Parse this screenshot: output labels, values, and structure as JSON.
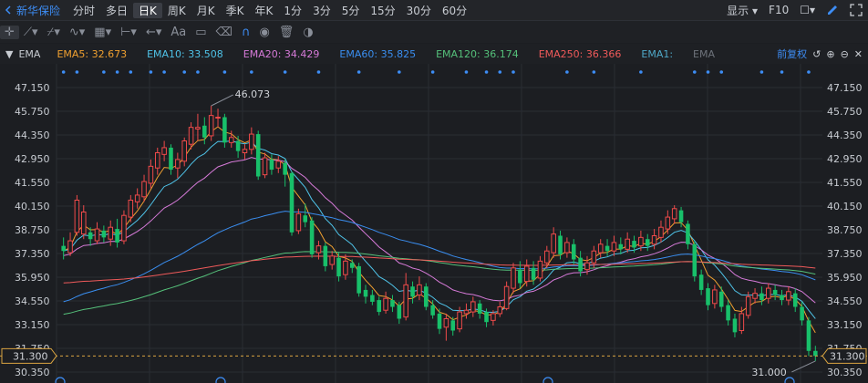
{
  "toolbar": {
    "stock_name": "新华保险",
    "periods": [
      "分时",
      "多日",
      "日K",
      "周K",
      "月K",
      "季K",
      "年K",
      "1分",
      "3分",
      "5分",
      "15分",
      "30分",
      "60分"
    ],
    "active_period": "日K",
    "display_label": "显示",
    "f10_label": "F10",
    "colors": {
      "accent": "#3d8df5"
    }
  },
  "drawing_tools": {
    "icons": [
      "crosshair-icon",
      "line-icon",
      "polyline-icon",
      "wave-icon",
      "pattern-icon",
      "measure-icon",
      "arrow-icon",
      "text-icon",
      "comment-icon",
      "eraser-icon",
      "magnet-icon",
      "eye-icon",
      "trash-icon",
      "toggle-icon"
    ],
    "text_tool_label": "Aa"
  },
  "indicator_bar": {
    "name": "EMA",
    "adjust_label": "前复权",
    "items": [
      {
        "label": "EMA5: 32.673",
        "color": "#f0a030"
      },
      {
        "label": "EMA10: 33.508",
        "color": "#4fc3e8"
      },
      {
        "label": "EMA20: 34.429",
        "color": "#d67ad8"
      },
      {
        "label": "EMA60: 35.825",
        "color": "#3a8ef0"
      },
      {
        "label": "EMA120: 36.174",
        "color": "#55c07a"
      },
      {
        "label": "EMA250: 36.366",
        "color": "#ef5a5a"
      },
      {
        "label": "EMA1:",
        "color": "#4fa8c8"
      },
      {
        "label": "EMA",
        "color": "#6e737b"
      }
    ]
  },
  "chart_data": {
    "type": "candlestick",
    "y_ticks": [
      "47.150",
      "45.750",
      "44.350",
      "42.950",
      "41.550",
      "40.150",
      "38.750",
      "37.350",
      "35.950",
      "34.550",
      "33.150",
      "31.750",
      "30.350"
    ],
    "ylim": [
      30.35,
      47.15
    ],
    "current_price_label": "31.300",
    "current_price": 31.3,
    "high_label": "46.073",
    "high_value": 46.073,
    "low_label": "31.000",
    "low_value": 31.0,
    "candles": [
      [
        37.8,
        37.5,
        38.3,
        37.0
      ],
      [
        37.4,
        38.1,
        38.6,
        37.2
      ],
      [
        38.6,
        40.5,
        40.8,
        38.4
      ],
      [
        38.5,
        39.8,
        40.2,
        38.2
      ],
      [
        38.6,
        38.2,
        38.9,
        37.8
      ],
      [
        38.1,
        38.8,
        39.2,
        37.9
      ],
      [
        38.7,
        38.3,
        39.0,
        38.0
      ],
      [
        38.2,
        38.9,
        39.3,
        37.8
      ],
      [
        38.8,
        38.0,
        39.4,
        37.7
      ],
      [
        38.1,
        39.6,
        39.9,
        37.9
      ],
      [
        39.5,
        40.5,
        40.8,
        39.2
      ],
      [
        40.4,
        40.8,
        41.2,
        40.0
      ],
      [
        40.7,
        41.6,
        42.0,
        40.4
      ],
      [
        41.5,
        42.5,
        42.9,
        41.2
      ],
      [
        42.4,
        43.3,
        43.6,
        42.0
      ],
      [
        43.2,
        43.6,
        44.0,
        42.8
      ],
      [
        43.6,
        42.3,
        43.8,
        42.0
      ],
      [
        42.4,
        42.9,
        43.3,
        41.8
      ],
      [
        42.8,
        44.0,
        44.2,
        42.5
      ],
      [
        43.8,
        44.8,
        45.1,
        43.5
      ],
      [
        44.7,
        44.8,
        45.6,
        44.0
      ],
      [
        44.9,
        44.2,
        45.4,
        43.8
      ],
      [
        44.3,
        45.5,
        46.073,
        44.0
      ],
      [
        45.4,
        45.4,
        45.9,
        44.8
      ],
      [
        45.4,
        43.9,
        45.6,
        43.6
      ],
      [
        43.9,
        44.2,
        44.6,
        43.6
      ],
      [
        44.0,
        43.4,
        44.3,
        43.0
      ],
      [
        43.3,
        43.5,
        43.8,
        42.9
      ],
      [
        43.5,
        44.4,
        44.8,
        43.2
      ],
      [
        44.4,
        41.9,
        44.6,
        41.7
      ],
      [
        42.0,
        43.0,
        43.3,
        41.8
      ],
      [
        42.9,
        42.3,
        43.2,
        42.0
      ],
      [
        42.4,
        42.8,
        43.1,
        42.1
      ],
      [
        42.7,
        42.0,
        42.9,
        41.3
      ],
      [
        42.1,
        38.6,
        42.2,
        38.4
      ],
      [
        38.7,
        39.7,
        40.0,
        38.5
      ],
      [
        39.6,
        39.2,
        40.3,
        38.9
      ],
      [
        39.3,
        37.3,
        39.5,
        37.1
      ],
      [
        37.4,
        37.8,
        38.1,
        37.0
      ],
      [
        37.8,
        36.6,
        38.0,
        36.3
      ],
      [
        36.7,
        37.2,
        37.5,
        36.4
      ],
      [
        37.1,
        36.0,
        37.4,
        35.7
      ],
      [
        36.1,
        36.9,
        37.3,
        35.8
      ],
      [
        36.8,
        36.5,
        37.0,
        36.2
      ],
      [
        36.6,
        35.0,
        36.8,
        34.8
      ],
      [
        35.2,
        34.8,
        35.5,
        34.4
      ],
      [
        34.9,
        34.5,
        35.2,
        34.3
      ],
      [
        34.6,
        33.9,
        34.8,
        33.7
      ],
      [
        34.0,
        34.7,
        35.1,
        33.8
      ],
      [
        34.6,
        34.2,
        34.9,
        33.9
      ],
      [
        34.3,
        33.5,
        34.5,
        33.2
      ],
      [
        33.6,
        35.5,
        36.2,
        33.4
      ],
      [
        35.4,
        34.8,
        35.7,
        34.4
      ],
      [
        34.9,
        35.5,
        36.0,
        34.6
      ],
      [
        35.4,
        34.2,
        35.6,
        34.0
      ],
      [
        34.3,
        33.7,
        34.6,
        33.5
      ],
      [
        33.8,
        32.9,
        34.1,
        32.6
      ],
      [
        33.0,
        33.5,
        33.8,
        32.2
      ],
      [
        33.4,
        32.8,
        33.6,
        32.5
      ],
      [
        32.9,
        33.9,
        34.2,
        32.7
      ],
      [
        33.8,
        34.0,
        34.4,
        33.5
      ],
      [
        33.9,
        34.5,
        34.8,
        33.6
      ],
      [
        34.4,
        33.8,
        34.6,
        33.5
      ],
      [
        33.9,
        33.3,
        34.1,
        33.0
      ],
      [
        33.4,
        33.8,
        34.0,
        33.1
      ],
      [
        33.8,
        34.2,
        34.5,
        33.6
      ],
      [
        34.1,
        35.4,
        35.7,
        34.0
      ],
      [
        35.3,
        36.5,
        36.8,
        35.0
      ],
      [
        36.4,
        35.6,
        36.9,
        35.3
      ],
      [
        35.7,
        36.6,
        37.0,
        35.4
      ],
      [
        36.5,
        35.8,
        36.9,
        35.5
      ],
      [
        35.9,
        36.9,
        37.2,
        35.7
      ],
      [
        36.8,
        37.5,
        37.8,
        36.5
      ],
      [
        37.4,
        38.5,
        38.9,
        37.1
      ],
      [
        38.4,
        37.3,
        38.7,
        37.0
      ],
      [
        37.4,
        38.0,
        38.3,
        37.1
      ],
      [
        37.9,
        37.0,
        38.2,
        36.7
      ],
      [
        37.1,
        36.3,
        37.5,
        36.0
      ],
      [
        36.4,
        36.8,
        37.2,
        36.1
      ],
      [
        36.8,
        37.5,
        37.8,
        36.5
      ],
      [
        37.4,
        37.9,
        38.2,
        37.1
      ],
      [
        37.8,
        37.5,
        38.2,
        37.2
      ],
      [
        37.5,
        38.0,
        38.4,
        37.2
      ],
      [
        37.9,
        37.6,
        38.3,
        37.3
      ],
      [
        37.6,
        38.2,
        38.6,
        37.4
      ],
      [
        38.1,
        37.7,
        38.4,
        37.4
      ],
      [
        37.8,
        38.3,
        38.7,
        37.5
      ],
      [
        38.2,
        37.8,
        38.5,
        37.5
      ],
      [
        37.9,
        38.4,
        38.8,
        37.6
      ],
      [
        38.3,
        38.9,
        39.3,
        38.0
      ],
      [
        38.8,
        39.5,
        39.9,
        38.5
      ],
      [
        39.4,
        40.0,
        40.2,
        39.1
      ],
      [
        39.9,
        39.2,
        40.1,
        38.9
      ],
      [
        39.1,
        37.9,
        39.3,
        37.6
      ],
      [
        37.9,
        36.0,
        38.1,
        35.7
      ],
      [
        36.1,
        35.2,
        36.4,
        34.9
      ],
      [
        35.3,
        34.3,
        35.6,
        34.0
      ],
      [
        34.4,
        35.2,
        35.5,
        34.1
      ],
      [
        35.1,
        34.2,
        35.4,
        33.9
      ],
      [
        34.3,
        33.4,
        34.6,
        33.1
      ],
      [
        33.5,
        32.7,
        33.8,
        32.4
      ],
      [
        32.8,
        33.8,
        34.2,
        32.6
      ],
      [
        33.7,
        34.8,
        35.1,
        33.5
      ],
      [
        34.7,
        35.0,
        35.3,
        34.4
      ],
      [
        35.0,
        34.6,
        35.4,
        34.3
      ],
      [
        34.7,
        35.3,
        35.6,
        34.4
      ],
      [
        35.2,
        34.9,
        35.5,
        34.6
      ],
      [
        34.9,
        34.6,
        35.2,
        34.3
      ],
      [
        34.6,
        35.1,
        35.4,
        34.3
      ],
      [
        35.0,
        34.2,
        35.3,
        33.9
      ],
      [
        34.2,
        33.4,
        34.5,
        33.1
      ],
      [
        33.4,
        31.6,
        33.6,
        31.3
      ],
      [
        31.6,
        31.3,
        31.9,
        31.0
      ]
    ],
    "grid": true
  }
}
